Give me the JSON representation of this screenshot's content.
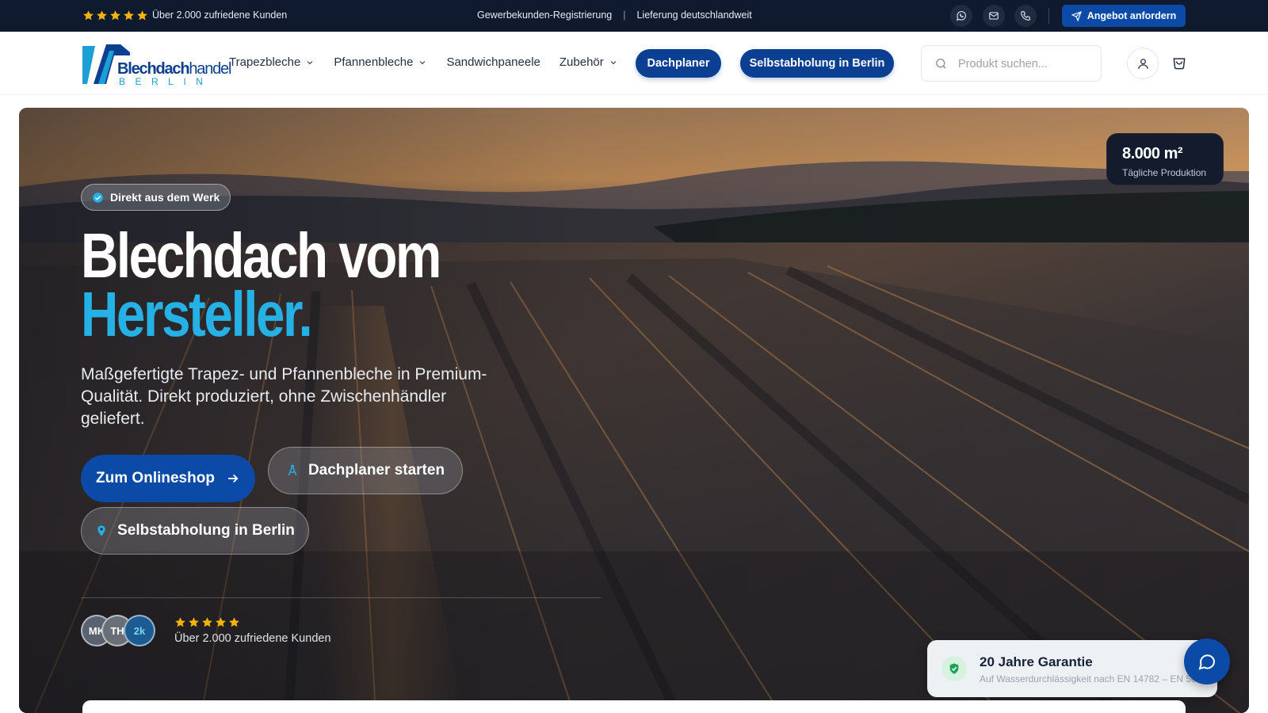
{
  "topbar": {
    "rating_text": "Über 2.000 zufriedene Kunden",
    "link_business": "Gewerbekunden-Registrierung",
    "separator": "|",
    "link_delivery": "Lieferung deutschlandweit",
    "offer_button": "Angebot anfordern",
    "icons": [
      "whatsapp-icon",
      "mail-icon",
      "phone-icon"
    ]
  },
  "header": {
    "logo": {
      "word_bold": "Blechdach",
      "word_light": "handel",
      "city": "BERLIN"
    },
    "nav": [
      {
        "label": "Trapezbleche",
        "has_dropdown": true
      },
      {
        "label": "Pfannenbleche",
        "has_dropdown": true
      },
      {
        "label": "Sandwichpaneele",
        "has_dropdown": false
      },
      {
        "label": "Zubehör",
        "has_dropdown": true
      }
    ],
    "pill_dachplaner": "Dachplaner",
    "pill_selbstabholung": "Selbstabholung in Berlin",
    "search_placeholder": "Produkt suchen..."
  },
  "hero": {
    "badge": "Direkt aus dem Werk",
    "headline_line1": "Blechdach vom",
    "headline_line2": "Hersteller.",
    "lead": "Maßgefertigte Trapez- und Pfannenbleche in Premium-Qualität. Direkt produziert, ohne Zwischenhändler geliefert.",
    "btn_shop": "Zum Onlineshop",
    "btn_planner": "Dachplaner starten",
    "btn_pickup": "Selbstabholung in Berlin",
    "avatars": [
      "MK",
      "TH",
      "2k"
    ],
    "rating_stars": 5,
    "proof_text": "Über 2.000 zufriedene Kunden",
    "stat_value": "8.000 m²",
    "stat_label": "Tägliche Produktion"
  },
  "guarantee": {
    "title": "20 Jahre Garantie",
    "subtitle": "Auf Wasserdurchlässigkeit nach EN 14782 – EN 508-"
  },
  "colors": {
    "navy": "#0f1a2e",
    "primary": "#0b4aa6",
    "pill": "#0b3f91",
    "accent": "#25b1e6",
    "star": "#f5b400",
    "success": "#1aa454"
  }
}
